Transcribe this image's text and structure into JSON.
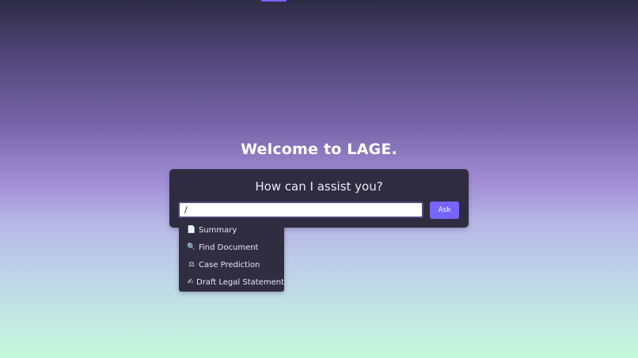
{
  "header": {
    "welcome": "Welcome to LAGE."
  },
  "panel": {
    "title": "How can I assist you?",
    "input_value": "/",
    "input_placeholder": "",
    "ask_label": "Ask"
  },
  "commands": [
    {
      "icon": "page-icon",
      "glyph": "📄",
      "label": "Summary"
    },
    {
      "icon": "magnifier-icon",
      "glyph": "🔍",
      "label": "Find Document"
    },
    {
      "icon": "scales-icon",
      "glyph": "⚖",
      "label": "Case Prediction"
    },
    {
      "icon": "writing-hand-icon",
      "glyph": "✍",
      "label": "Draft Legal Statement"
    }
  ],
  "colors": {
    "accent": "#7565ff",
    "panel": "#2f2c41",
    "gradient_top": "#2e2b45",
    "gradient_mid": "#a28ed6",
    "gradient_bottom": "#c6f8dc"
  }
}
